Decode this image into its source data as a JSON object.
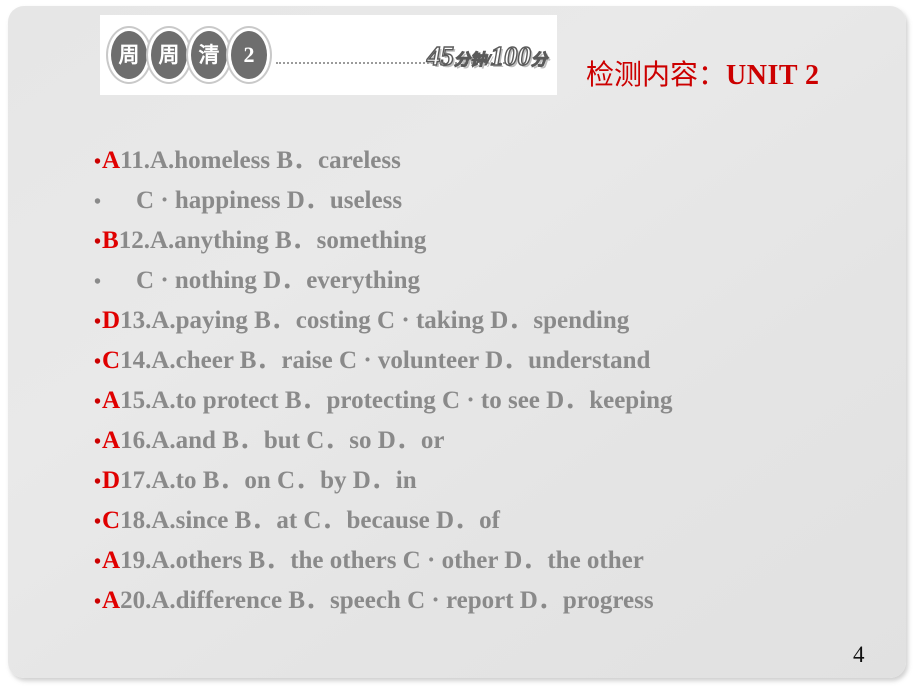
{
  "slide": {
    "page_number": "4",
    "background_color": "#e6e6e6"
  },
  "banner": {
    "badges": [
      {
        "name": "badge-zhou-1",
        "glyph": "周"
      },
      {
        "name": "badge-zhou-2",
        "glyph": "周"
      },
      {
        "name": "badge-qing",
        "glyph": "清"
      },
      {
        "name": "badge-number",
        "glyph": "2"
      }
    ],
    "score_main": "45",
    "score_unit_1": "分钟/",
    "score_total": "100",
    "score_unit_2": "分",
    "score_full": "45分钟/100分"
  },
  "title": {
    "label": "检测内容：",
    "unit": "UNIT 2",
    "color": "#cc0000"
  },
  "questions": [
    {
      "bullet": "•",
      "answer": "A",
      "text": "11.A.homeless        B．careless",
      "continuation": {
        "bullet": "•",
        "text": "C · happiness   D．useless"
      }
    },
    {
      "bullet": "•",
      "answer": "B",
      "text": "12.A.anything  B．something",
      "continuation": {
        "bullet": "•",
        "text": "C · nothing  D．everything"
      }
    },
    {
      "bullet": "•",
      "answer": "D",
      "text": "13.A.paying  B．costing     C · taking  D．spending",
      "continuation": null
    },
    {
      "bullet": "•",
      "answer": "C",
      "text": "14.A.cheer  B．raise   C · volunteer  D．understand",
      "continuation": null
    },
    {
      "bullet": "•",
      "answer": "A",
      "text": "15.A.to protect  B．protecting  C · to see  D．keeping",
      "continuation": null
    },
    {
      "bullet": "•",
      "answer": "A",
      "text": "16.A.and  B．but  C．so  D．or",
      "continuation": null
    },
    {
      "bullet": "•",
      "answer": "D",
      "text": "17.A.to  B．on  C．by  D．in",
      "continuation": null
    },
    {
      "bullet": "•",
      "answer": "C",
      "text": "18.A.since  B．at  C．because  D．of",
      "continuation": null
    },
    {
      "bullet": "•",
      "answer": "A",
      "text": "19.A.others  B．the others     C · other  D．the other",
      "continuation": null
    },
    {
      "bullet": "•",
      "answer": "A",
      "text": "20.A.difference  B．speech     C · report  D．progress",
      "continuation": null
    }
  ]
}
